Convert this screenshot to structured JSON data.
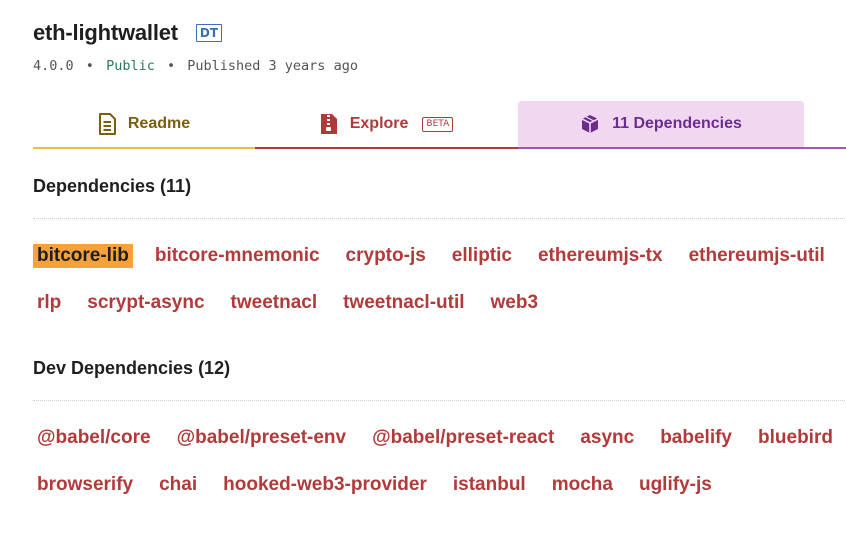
{
  "package": {
    "name": "eth-lightwallet",
    "types_badge": "DT",
    "version": "4.0.0",
    "visibility": "Public",
    "published": "Published 3 years ago",
    "separator": "•"
  },
  "tabs": [
    {
      "label": "Readme",
      "icon": "readme-doc-icon",
      "color": "#7a5e12"
    },
    {
      "label": "Explore",
      "icon": "zip-file-icon",
      "badge": "BETA",
      "color": "#b03a3a"
    },
    {
      "label": "11 Dependencies",
      "icon": "box-icon",
      "color": "#6b2e8f",
      "active": true
    }
  ],
  "dependencies": {
    "title": "Dependencies (11)",
    "row1": [
      "bitcore-lib",
      "bitcore-mnemonic",
      "crypto-js",
      "elliptic",
      "ethereumjs-tx",
      "ethereumjs-util"
    ],
    "row2": [
      "rlp",
      "scrypt-async",
      "tweetnacl",
      "tweetnacl-util",
      "web3"
    ],
    "highlighted": "bitcore-lib"
  },
  "dev_dependencies": {
    "title": "Dev Dependencies (12)",
    "row1": [
      "@babel/core",
      "@babel/preset-env",
      "@babel/preset-react",
      "async",
      "babelify",
      "bluebird"
    ],
    "row2": [
      "browserify",
      "chai",
      "hooked-web3-provider",
      "istanbul",
      "mocha",
      "uglify-js"
    ]
  },
  "colors": {
    "link": "#b23a3a",
    "highlight_bg": "#f4a23a",
    "deps_tab_bg": "#f2d7f1",
    "readme_accent": "#e3c33f",
    "explore_accent": "#b03a3a",
    "deps_accent": "#9b59b6"
  }
}
